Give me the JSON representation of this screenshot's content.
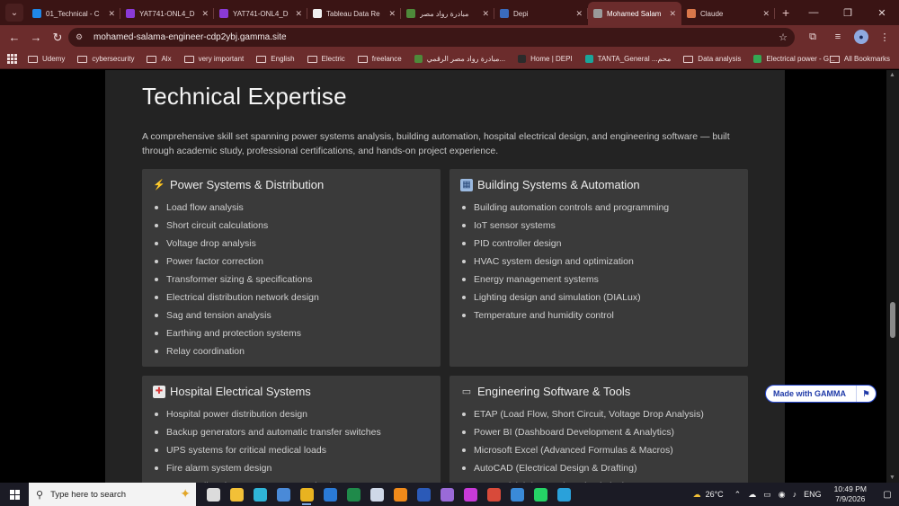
{
  "browser": {
    "tabs": [
      {
        "title": "01_Technical - C",
        "color": "#1f87e8",
        "active": false
      },
      {
        "title": "YAT741-ONL4_D",
        "color": "#8a3ad6",
        "active": false
      },
      {
        "title": "YAT741-ONL4_D",
        "color": "#8a3ad6",
        "active": false
      },
      {
        "title": "Tableau Data Re",
        "color": "#f0f0f0",
        "active": false
      },
      {
        "title": "مبادرة رواد مصر",
        "color": "#4e8a3a",
        "active": false
      },
      {
        "title": "Depi",
        "color": "#3a6bbd",
        "active": false
      },
      {
        "title": "Mohamed Salam",
        "color": "#9a9a9a",
        "active": true
      },
      {
        "title": "Claude",
        "color": "#d9774a",
        "active": false
      }
    ],
    "url": "mohamed-salama-engineer-cdp2ybj.gamma.site",
    "bookmarks": [
      {
        "label": "Udemy",
        "type": "folder"
      },
      {
        "label": "cybersecurity",
        "type": "folder"
      },
      {
        "label": "Alx",
        "type": "folder"
      },
      {
        "label": "very important",
        "type": "folder"
      },
      {
        "label": "English",
        "type": "folder"
      },
      {
        "label": "Electric",
        "type": "folder"
      },
      {
        "label": "freelance",
        "type": "folder"
      },
      {
        "label": "مبادرة رواد مصر الرقمي...",
        "type": "fav",
        "color": "#4e8a3a"
      },
      {
        "label": "Home | DEPI",
        "type": "fav",
        "color": "#2b2b2b"
      },
      {
        "label": "TANTA_General ...محم",
        "type": "fav",
        "color": "#1aa59a"
      },
      {
        "label": "Data analysis",
        "type": "folder"
      },
      {
        "label": "Electrical power - G...",
        "type": "fav",
        "color": "#34a853"
      }
    ],
    "all_bookmarks": "All Bookmarks"
  },
  "page": {
    "title": "Technical Expertise",
    "intro": "A comprehensive skill set spanning power systems analysis, building automation, hospital electrical design, and engineering software — built through academic study, professional certifications, and hands-on project experience.",
    "cards": [
      {
        "icon": "⚡",
        "icon_name": "lightning-icon",
        "icon_bg": "transparent",
        "title": "Power Systems & Distribution",
        "items": [
          "Load flow analysis",
          "Short circuit calculations",
          "Voltage drop analysis",
          "Power factor correction",
          "Transformer sizing & specifications",
          "Electrical distribution network design",
          "Sag and tension analysis",
          "Earthing and protection systems",
          "Relay coordination"
        ]
      },
      {
        "icon": "▦",
        "icon_name": "building-icon",
        "icon_bg": "#9ab9e0",
        "title": "Building Systems & Automation",
        "items": [
          "Building automation controls and programming",
          "IoT sensor systems",
          "PID controller design",
          "HVAC system design and optimization",
          "Energy management systems",
          "Lighting design and simulation (DIALux)",
          "Temperature and humidity control"
        ]
      },
      {
        "icon": "✚",
        "icon_name": "hospital-icon",
        "icon_bg": "#e9e9e9",
        "title": "Hospital Electrical Systems",
        "items": [
          "Hospital power distribution design",
          "Backup generators and automatic transfer switches",
          "UPS systems for critical medical loads",
          "Fire alarm system design",
          "Nurse call and emergency communication systems"
        ]
      },
      {
        "icon": "▭",
        "icon_name": "laptop-icon",
        "icon_bg": "transparent",
        "title": "Engineering Software & Tools",
        "items": [
          "ETAP (Load Flow, Short Circuit, Voltage Drop Analysis)",
          "Power BI (Dashboard Development & Analytics)",
          "Microsoft Excel (Advanced Formulas & Macros)",
          "AutoCAD (Electrical Design & Drafting)",
          "DIALux (Lighting Design Simulation)"
        ]
      }
    ],
    "badge": "Made with GAMMA"
  },
  "taskbar": {
    "search_placeholder": "Type here to search",
    "apps": [
      {
        "name": "task-view-icon",
        "color": "#dcdcdc",
        "on": false
      },
      {
        "name": "file-explorer-icon",
        "color": "#f2c037",
        "on": false
      },
      {
        "name": "edge-icon",
        "color": "#2fb5d8",
        "on": false
      },
      {
        "name": "photos-icon",
        "color": "#4a8ad8",
        "on": false
      },
      {
        "name": "chrome-icon",
        "color": "#e8b320",
        "on": true
      },
      {
        "name": "outlook-icon",
        "color": "#2a7ad6",
        "on": false
      },
      {
        "name": "excel-icon",
        "color": "#1f8a4a",
        "on": false
      },
      {
        "name": "mail-icon",
        "color": "#cfd8e8",
        "on": false
      },
      {
        "name": "vlc-icon",
        "color": "#f08a1a",
        "on": false
      },
      {
        "name": "word-icon",
        "color": "#2b5ab8",
        "on": false
      },
      {
        "name": "copilot-icon",
        "color": "#9a6ad8",
        "on": false
      },
      {
        "name": "messenger-icon",
        "color": "#c83ad8",
        "on": false
      },
      {
        "name": "snipping-icon",
        "color": "#d84a3a",
        "on": false
      },
      {
        "name": "remote-desktop-icon",
        "color": "#3a8ad8",
        "on": false
      },
      {
        "name": "whatsapp-icon",
        "color": "#25d366",
        "on": false
      },
      {
        "name": "telegram-icon",
        "color": "#2aa1da",
        "on": false
      }
    ],
    "weather": "26°C",
    "language": "ENG",
    "time": "10:49 PM",
    "date": "7/9/2026"
  }
}
